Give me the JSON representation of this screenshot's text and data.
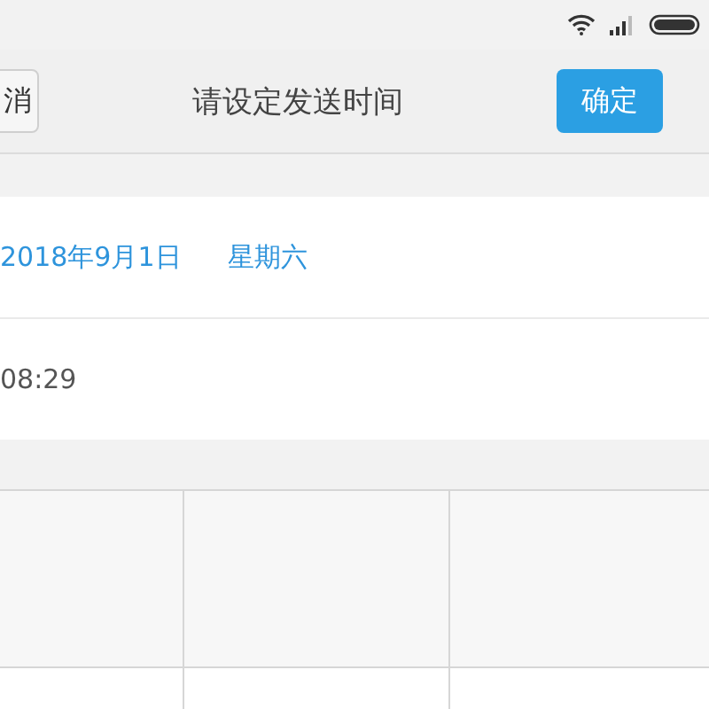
{
  "header": {
    "cancel_button": "消",
    "title": "请设定发送时间",
    "confirm_button": "确定"
  },
  "date_row": {
    "date": "2018年9月1日",
    "weekday": "星期六"
  },
  "time_row": {
    "time": "08:29"
  },
  "grid": {
    "rows": [
      {
        "kind": "shaded"
      },
      {
        "kind": "plain"
      }
    ]
  }
}
